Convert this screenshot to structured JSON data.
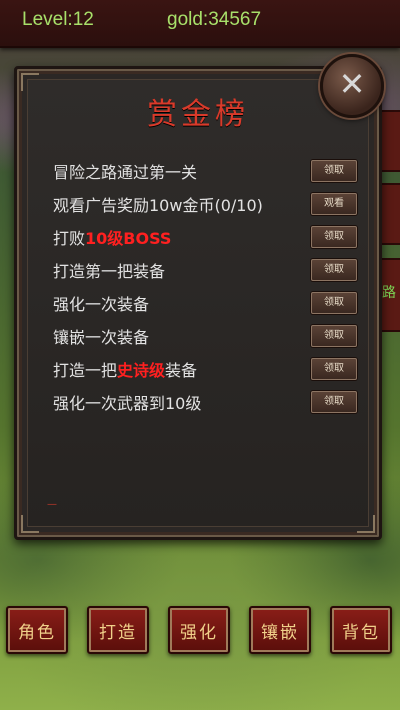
{
  "hud": {
    "level": "Level:12",
    "gold": "gold:34567"
  },
  "side_tab_glyph": "路",
  "panel": {
    "title": "赏金榜",
    "close_icon": "close-icon",
    "footer_mark": "—"
  },
  "quests": [
    {
      "parts": [
        "冒险之路通过第一关"
      ],
      "button": "领取"
    },
    {
      "parts": [
        "观看广告奖励10w金币(0/10)"
      ],
      "button": "观看"
    },
    {
      "parts": [
        "打败",
        "10级BOSS",
        ""
      ],
      "button": "领取"
    },
    {
      "parts": [
        "打造第一把装备"
      ],
      "button": "领取"
    },
    {
      "parts": [
        "强化一次装备"
      ],
      "button": "领取"
    },
    {
      "parts": [
        "镶嵌一次装备"
      ],
      "button": "领取"
    },
    {
      "parts": [
        "打造一把",
        "史诗级",
        "装备"
      ],
      "button": "领取"
    },
    {
      "parts": [
        "强化一次武器到10级"
      ],
      "button": "领取"
    }
  ],
  "bottom_nav": [
    "角色",
    "打造",
    "强化",
    "镶嵌",
    "背包"
  ],
  "colors": {
    "highlight": "#ff2020",
    "title": "#d93a2a",
    "hud_text": "#a8e06a"
  }
}
